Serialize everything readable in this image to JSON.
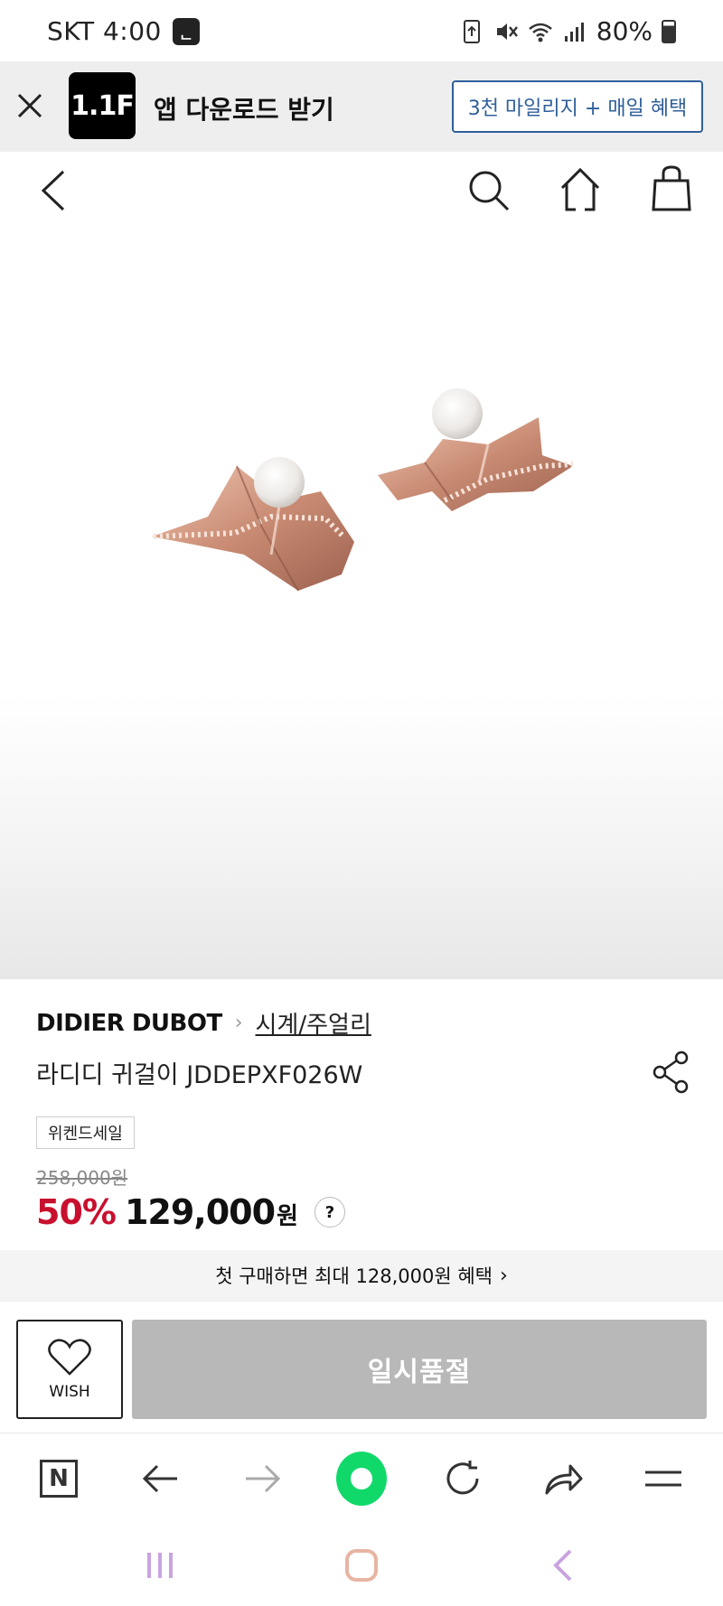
{
  "status_bar": {
    "carrier_time": "SKT 4:00",
    "app_badge": "ᆫ",
    "battery": "80%",
    "icons": [
      "recycle-icon",
      "mute-icon",
      "wifi-icon",
      "signal-icon",
      "battery-icon"
    ]
  },
  "app_banner": {
    "logo_text": "1.1F",
    "title": "앱 다운로드 받기",
    "cta_label": "3천 마일리지 + 매일 혜택",
    "accent_color": "#2f5f9a"
  },
  "product": {
    "brand": "DIDIER DUBOT",
    "category": "시계/주얼리",
    "name": "라디디 귀걸이 JDDEPXF026W",
    "badge": "위켄드세일",
    "original_price": "258,000원",
    "discount_rate": "50%",
    "sale_price": "129,000",
    "price_unit": "원",
    "help_label": "?",
    "discount_color": "#c8102e"
  },
  "benefit": {
    "text": "첫 구매하면 최대 128,000원 혜택"
  },
  "purchase": {
    "wish_label": "WISH",
    "soldout_label": "일시품절"
  },
  "browser": {
    "n_label": "N",
    "buttons": [
      "naver-home",
      "back",
      "forward",
      "green-dot",
      "refresh",
      "share",
      "menu"
    ],
    "brand_color": "#10d96a"
  }
}
